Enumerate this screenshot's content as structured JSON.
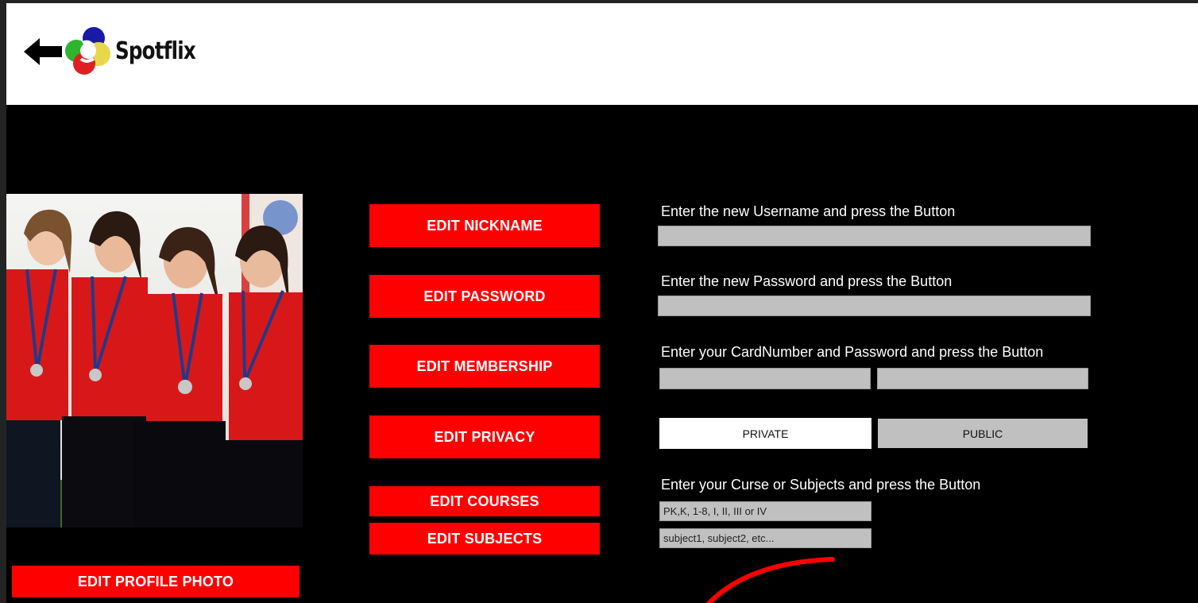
{
  "header": {
    "brand_name": "Spotflix",
    "back_icon": "back-arrow-icon",
    "logo_icon": "spotflix-logo-icon"
  },
  "profile": {
    "photo_icon": "team-photo",
    "edit_photo_label": "EDIT PROFILE PHOTO"
  },
  "actions": {
    "nickname_label": "EDIT NICKNAME",
    "password_label": "EDIT PASSWORD",
    "membership_label": "EDIT MEMBERSHIP",
    "privacy_label": "EDIT PRIVACY",
    "courses_label": "EDIT COURSES",
    "subjects_label": "EDIT SUBJECTS"
  },
  "forms": {
    "username_prompt": "Enter the new Username and press the Button",
    "username_value": "",
    "password_prompt": "Enter the new Password and press the Button",
    "password_value": "",
    "membership_prompt": "Enter your CardNumber and Password and press the Button",
    "card_number_value": "",
    "card_password_value": "",
    "privacy_private_label": "PRIVATE",
    "privacy_public_label": "PUBLIC",
    "privacy_selected": "PRIVATE",
    "courses_prompt": "Enter your Curse or Subjects and press the Button",
    "courses_placeholder": "PK,K, 1-8, I, II, III or IV",
    "subjects_placeholder": "subject1, subject2, etc..."
  },
  "colors": {
    "accent_red": "#ff0000",
    "field_gray": "#c0c0c0",
    "background": "#000000",
    "header_bg": "#ffffff"
  }
}
